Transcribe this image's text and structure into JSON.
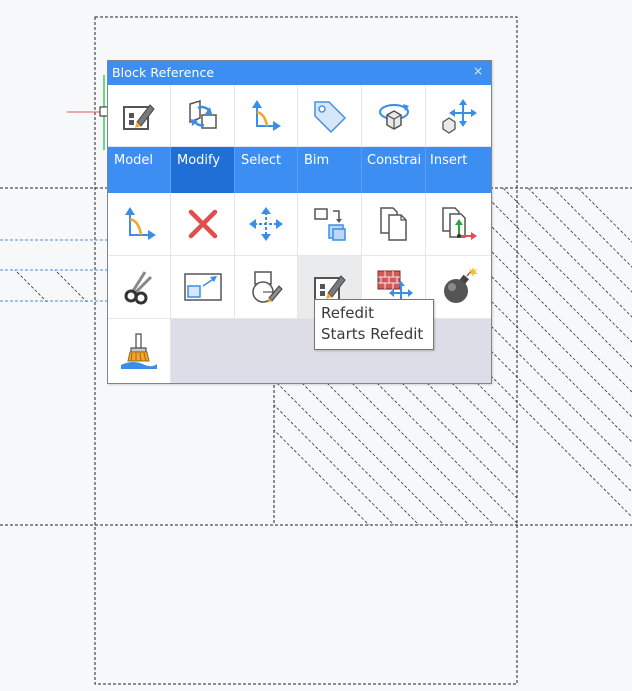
{
  "panel": {
    "title": "Block Reference",
    "close_glyph": "×",
    "categories": [
      {
        "label": "Model",
        "active": false
      },
      {
        "label": "Modify",
        "active": true
      },
      {
        "label": "Select",
        "active": false
      },
      {
        "label": "Bim",
        "active": false
      },
      {
        "label": "Constrai",
        "active": false
      },
      {
        "label": "Insert",
        "active": false
      }
    ],
    "top_icons": [
      "block-edit-icon",
      "modify-blocks-icon",
      "select-corner-icon",
      "bim-tag-icon",
      "constraint-orbit-icon",
      "insert-move-icon"
    ],
    "tool_icons": [
      "corner-select-icon",
      "delete-x-icon",
      "move-arrows-icon",
      "copy-stack-icon",
      "copy-pages-icon",
      "paste-coordinate-icon",
      "scissors-icon",
      "scale-icon",
      "explode-circle-icon",
      "refedit-icon",
      "brick-move-icon",
      "bomb-icon",
      "paintbrush-icon"
    ]
  },
  "tooltip": {
    "title": "Refedit",
    "description": "Starts Refedit"
  },
  "colors": {
    "accent": "#3c8ef3",
    "active_tab": "#1f6fd6",
    "filler": "#dddde8",
    "icon_blue": "#3a8ee6",
    "icon_orange": "#f3a52c",
    "delete_red": "#e34d4d"
  }
}
